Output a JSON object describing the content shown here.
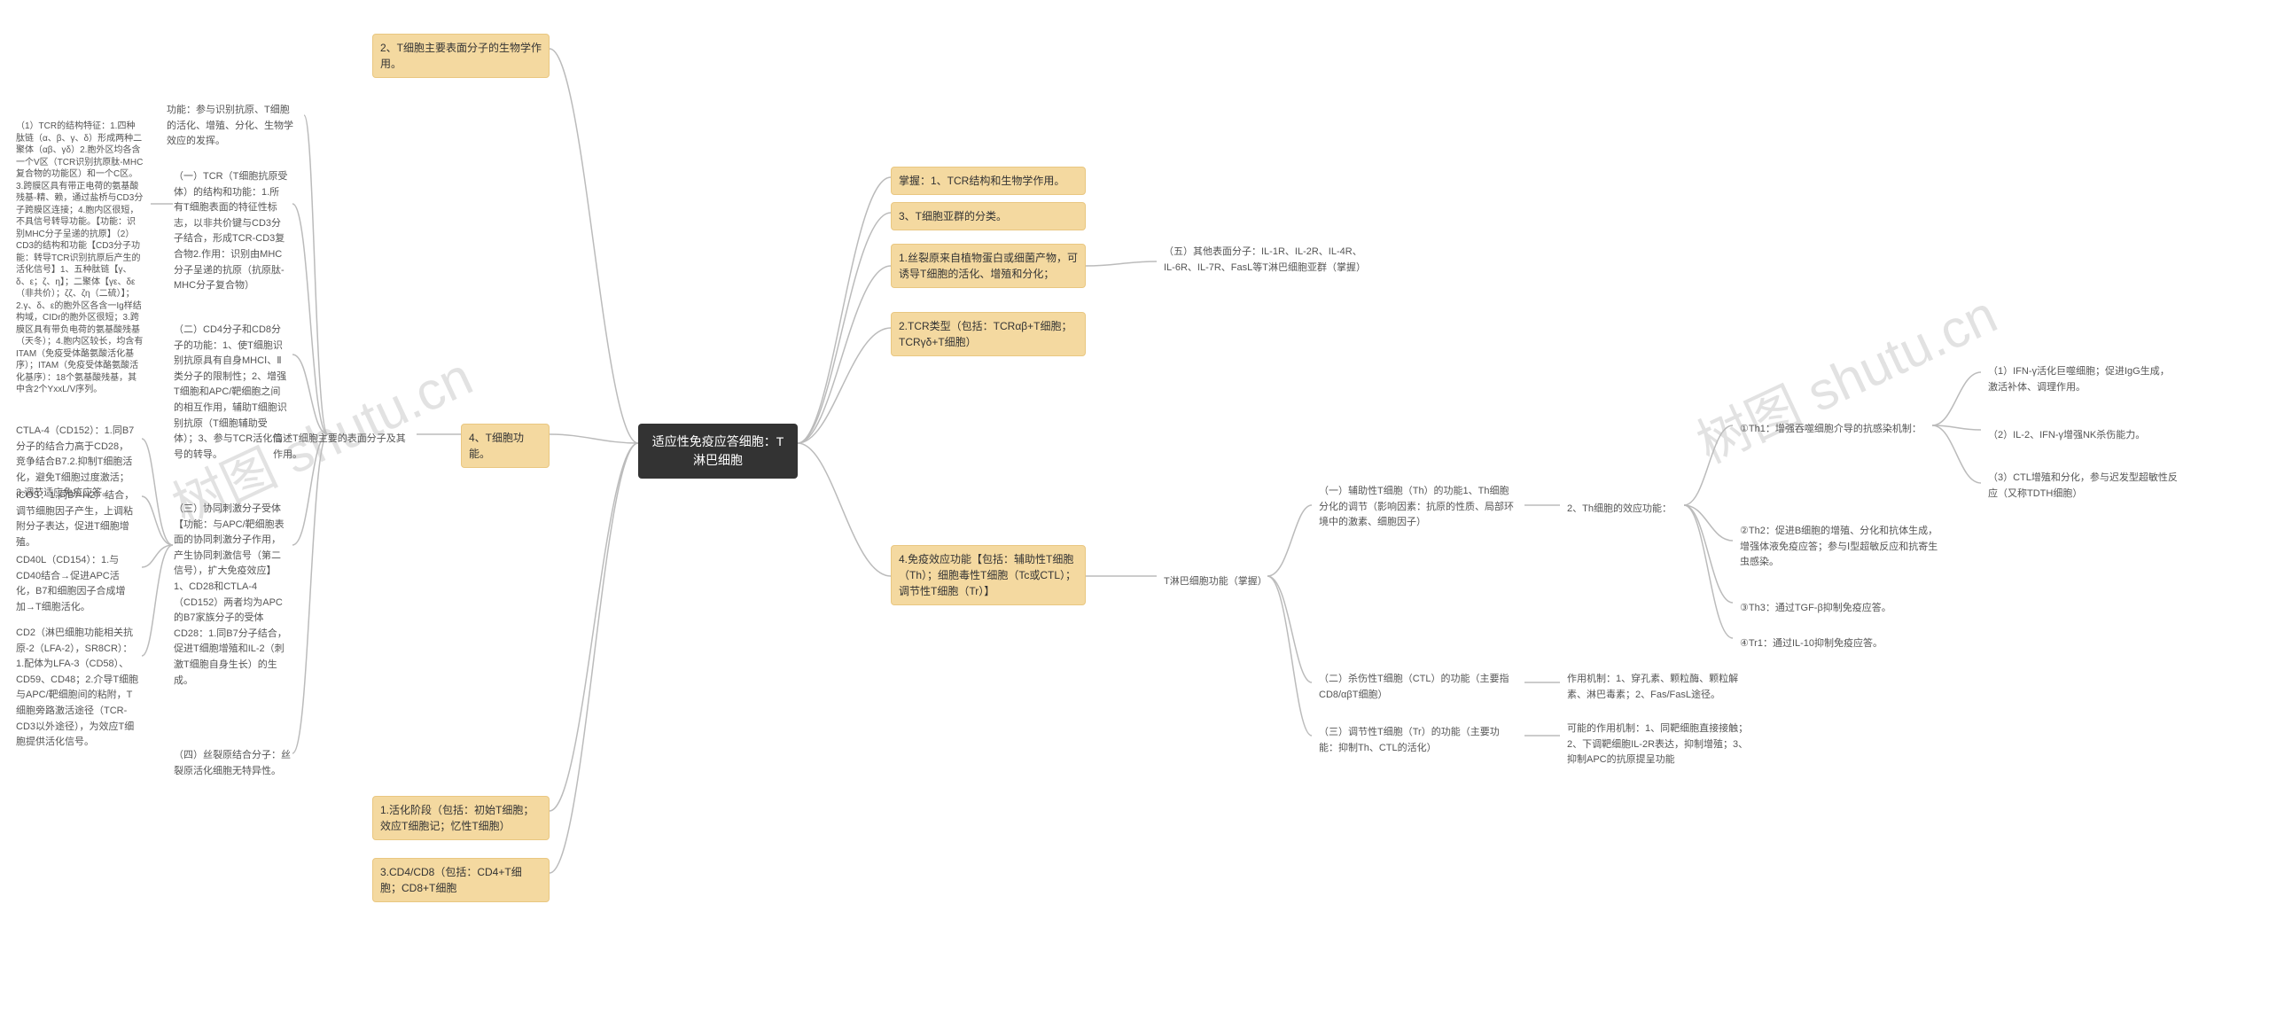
{
  "watermark_text": "树图 shutu.cn",
  "root": {
    "title": "适应性免疫应答细胞：T淋巴细胞"
  },
  "right": {
    "r1": "掌握：1、TCR结构和生物学作用。",
    "r2": "3、T细胞亚群的分类。",
    "r3": "1.丝裂原来自植物蛋白或细菌产物，可诱导T细胞的活化、增殖和分化；",
    "r3a": "（五）其他表面分子：IL-1R、IL-2R、IL-4R、IL-6R、IL-7R、FasL等T淋巴细胞亚群（掌握）",
    "r4": "2.TCR类型（包括：TCRαβ+T细胞；TCRγδ+T细胞）",
    "r5": "4.免疫效应功能【包括：辅助性T细胞（Th）；细胞毒性T细胞（Tc或CTL）；调节性T细胞（Tr）】",
    "r5a": "T淋巴细胞功能（掌握）",
    "r5b1": "（一）辅助性T细胞（Th）的功能1、Th细胞分化的调节（影响因素：抗原的性质、局部环境中的激素、细胞因子）",
    "r5b1_next": "2、Th细胞的效应功能：",
    "th1": "①Th1：增强吞噬细胞介导的抗感染机制：",
    "th1_1": "（1）IFN-γ活化巨噬细胞；促进IgG生成，激活补体、调理作用。",
    "th1_2": "（2）IL-2、IFN-γ增强NK杀伤能力。",
    "th1_3": "（3）CTL增殖和分化，参与迟发型超敏性反应（又称TDTH细胞）",
    "th2": "②Th2：促进B细胞的增殖、分化和抗体生成，增强体液免疫应答；参与Ⅰ型超敏反应和抗寄生虫感染。",
    "th3": "③Th3：通过TGF-β抑制免疫应答。",
    "tr1": "④Tr1：通过IL-10抑制免疫应答。",
    "r5b2": "（二）杀伤性T细胞（CTL）的功能（主要指CD8/αβT细胞）",
    "r5b2_next": "作用机制：1、穿孔素、颗粒酶、颗粒解素、淋巴毒素；2、Fas/FasL途径。",
    "r5b3": "（三）调节性T细胞（Tr）的功能（主要功能：抑制Th、CTL的活化）",
    "r5b3_next": "可能的作用机制：1、同靶细胞直接接触；2、下调靶细胞IL-2R表达，抑制增殖；3、抑制APC的抗原提呈功能"
  },
  "left": {
    "l1": "2、T细胞主要表面分子的生物学作用。",
    "l2": "4、T细胞功能。",
    "l2a": "简述T细胞主要的表面分子及其作用。",
    "l2a_fn": "功能：参与识别抗原、T细胞的活化、增殖、分化、生物学效应的发挥。",
    "l2a_1": "（一）TCR（T细胞抗原受体）的结构和功能：1.所有T细胞表面的特征性标志，以非共价键与CD3分子结合，形成TCR-CD3复合物2.作用：识别由MHC分子呈递的抗原（抗原肽-MHC分子复合物）",
    "l2a_1_detail": "（1）TCR的结构特征：1.四种肽链（α、β、γ、δ）形成两种二聚体（αβ、γδ）2.胞外区均各含一个V区（TCR识别抗原肽-MHC复合物的功能区）和一个C区。3.跨膜区具有带正电荷的氨基酸残基-精、赖，通过盐桥与CD3分子跨膜区连接；4.胞内区很短，不具信号转导功能。【功能：识别MHC分子呈递的抗原】（2）CD3的结构和功能【CD3分子功能：转导TCR识别抗原后产生的活化信号】1、五种肽链【γ、δ、ε；ζ、η】；二聚体【γε、δε（非共价）；ζζ、ζη（二硫）】；2.γ、δ、ε的胞外区各含一Ig样结构域，CIDr的胞外区很短；3.跨膜区具有带负电荷的氨基酸残基（天冬）；4.胞内区较长，均含有ITAM（免疫受体酪氨酸活化基序）；ITAM（免疫受体酪氨酸活化基序）：18个氨基酸残基，其中含2个YxxL/V序列。",
    "l2a_2": "（二）CD4分子和CD8分子的功能：1、使T细胞识别抗原具有自身MHCⅠ、Ⅱ类分子的限制性；2、增强T细胞和APC/靶细胞之间的相互作用，辅助T细胞识别抗原（T细胞辅助受体）；3、参与TCR活化信号的转导。",
    "l2a_3": "（三）协同刺激分子受体【功能：与APC/靶细胞表面的协同刺激分子作用，产生协同刺激信号（第二信号），扩大免疫效应】1、CD28和CTLA-4（CD152）两者均为APC的B7家族分子的受体CD28：1.同B7分子结合，促进T细胞增殖和IL-2（刺激T细胞自身生长）的生成。",
    "ctla4": "CTLA-4（CD152）：1.同B7分子的结合力高于CD28，竞争结合B7.2.抑制T细胞活化，避免T细胞过度激活；3.调节适应免疫应答。",
    "icos": "ICOS：1.同B7-H2）结合，调节细胞因子产生，上调粘附分子表达，促进T细胞增殖。",
    "cd40l": "CD40L（CD154）：1.与CD40结合→促进APC活化，B7和细胞因子合成增加→T细胞活化。",
    "cd2": "CD2（淋巴细胞功能相关抗原-2（LFA-2），SR8CR）：1.配体为LFA-3（CD58）、CD59、CD48；2.介导T细胞与APC/靶细胞间的粘附，T细胞旁路激活途径（TCR-CD3以外途径），为效应T细胞提供活化信号。",
    "l2a_4": "（四）丝裂原结合分子：丝裂原活化细胞无特异性。",
    "l3": "1.活化阶段（包括：初始T细胞；效应T细胞记；忆性T细胞）",
    "l4": "3.CD4/CD8（包括：CD4+T细胞；CD8+T细胞"
  }
}
